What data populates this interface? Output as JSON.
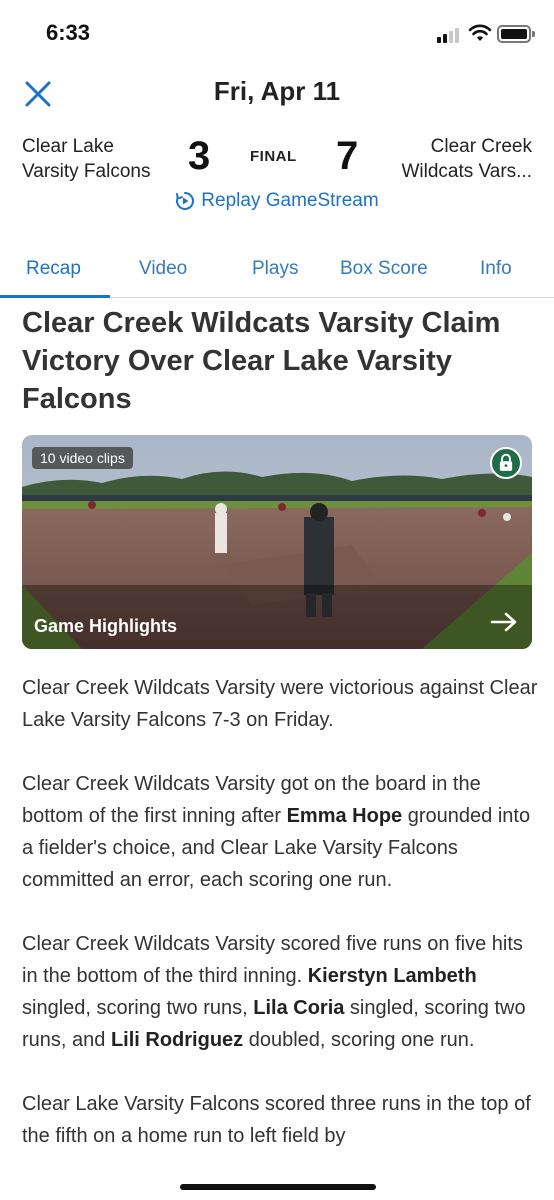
{
  "status_bar": {
    "time": "6:33"
  },
  "header": {
    "date": "Fri, Apr 11"
  },
  "scoreboard": {
    "home_team_line1": "Clear Lake",
    "home_team_line2": "Varsity Falcons",
    "home_score": "3",
    "status": "FINAL",
    "away_score": "7",
    "away_team_line1": "Clear Creek",
    "away_team_line2": "Wildcats Vars...",
    "replay_label": "Replay GameStream"
  },
  "tabs": [
    "Recap",
    "Video",
    "Plays",
    "Box Score",
    "Info"
  ],
  "article": {
    "title": "Clear Creek Wildcats Varsity Claim Victory Over Clear Lake Varsity Falcons",
    "video": {
      "clips_label": "10 video clips",
      "caption": "Game Highlights"
    },
    "p1": "Clear Creek Wildcats Varsity were victorious against Clear Lake Varsity Falcons 7-3 on Friday.",
    "p2_a": "Clear Creek Wildcats Varsity got on the board in the bottom of the first inning after ",
    "p2_name1": "Emma Hope",
    "p2_b": " grounded into a fielder's choice, and Clear Lake Varsity Falcons committed an error, each scoring one run.",
    "p3_a": "Clear Creek Wildcats Varsity scored five runs on five hits in the bottom of the third inning. ",
    "p3_name1": "Kierstyn Lambeth",
    "p3_b": " singled, scoring two runs, ",
    "p3_name2": "Lila Coria",
    "p3_c": " singled, scoring two runs, and ",
    "p3_name3": "Lili Rodriguez",
    "p3_d": " doubled, scoring one run.",
    "p4": "Clear Lake Varsity Falcons scored three runs in the top of the fifth on a home run to left field by"
  },
  "colors": {
    "accent": "#1a73c8",
    "lock_badge": "#1f6b4a"
  },
  "icons": {
    "close": "close-icon",
    "replay": "replay-icon",
    "lock": "lock-icon",
    "arrow": "arrow-right-icon"
  }
}
